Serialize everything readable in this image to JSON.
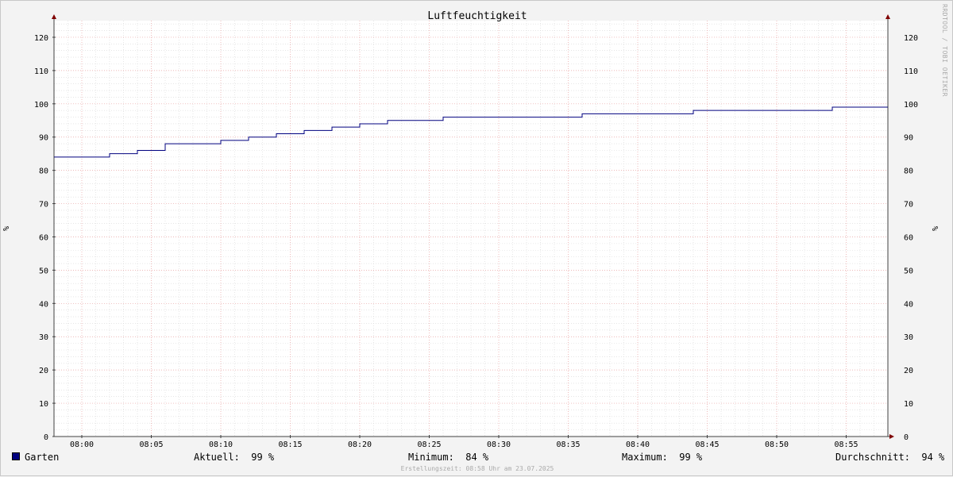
{
  "chart_data": {
    "type": "line",
    "title": "Luftfeuchtigkeit",
    "ylabel": "%",
    "ylabel_right": "%",
    "ylim": [
      0,
      125
    ],
    "yticks": [
      0,
      10,
      20,
      30,
      40,
      50,
      60,
      70,
      80,
      90,
      100,
      110,
      120
    ],
    "xlim": [
      "07:58",
      "08:58"
    ],
    "xticks": [
      "08:00",
      "08:05",
      "08:10",
      "08:15",
      "08:20",
      "08:25",
      "08:30",
      "08:35",
      "08:40",
      "08:45",
      "08:50",
      "08:55"
    ],
    "grid": true,
    "series": [
      {
        "name": "Garten",
        "color": "#00007f",
        "step": true,
        "x": [
          "07:58",
          "08:02",
          "08:04",
          "08:06",
          "08:10",
          "08:12",
          "08:14",
          "08:16",
          "08:18",
          "08:20",
          "08:22",
          "08:26",
          "08:36",
          "08:44",
          "08:54",
          "08:58"
        ],
        "values": [
          84,
          85,
          86,
          88,
          89,
          90,
          91,
          92,
          93,
          94,
          95,
          96,
          97,
          98,
          99,
          99
        ]
      }
    ]
  },
  "legend": {
    "series_name": "Garten",
    "current_label": "Aktuell:",
    "current_value": "99 %",
    "min_label": "Minimum:",
    "min_value": "84 %",
    "max_label": "Maximum:",
    "max_value": "99 %",
    "avg_label": "Durchschnitt:",
    "avg_value": "94 %"
  },
  "footer": "Erstellungszeit: 08:58 Uhr am 23.07.2025",
  "watermark": "RRDTOOL / TOBI OETIKER",
  "colors": {
    "background": "#f3f3f3",
    "plot_background": "#ffffff",
    "minor_grid": "#d8d8d8",
    "major_grid": "#e8a0a0",
    "axis": "#000000",
    "arrow": "#7f0000"
  }
}
